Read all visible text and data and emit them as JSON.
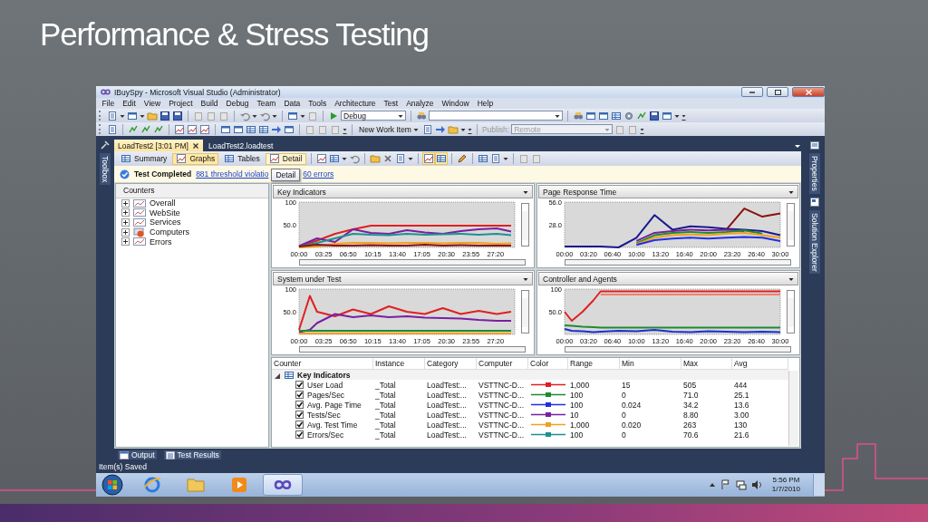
{
  "slide": {
    "title": "Performance & Stress Testing"
  },
  "window": {
    "title": "IBuySpy - Microsoft Visual Studio (Administrator)"
  },
  "menu": [
    "File",
    "Edit",
    "View",
    "Project",
    "Build",
    "Debug",
    "Team",
    "Data",
    "Tools",
    "Architecture",
    "Test",
    "Analyze",
    "Window",
    "Help"
  ],
  "toolbar": {
    "configuration": "Debug"
  },
  "toolbar2": {
    "new_work_item": "New Work Item",
    "publish_label": "Publish:",
    "publish_target": "Remote"
  },
  "side_tabs": {
    "left": [
      "Toolbox"
    ],
    "right": [
      "Properties",
      "Solution Explorer"
    ]
  },
  "document_tabs": [
    {
      "label": "LoadTest2 [3:01 PM]",
      "selected": true
    },
    {
      "label": "LoadTest2.loadtest",
      "selected": false
    }
  ],
  "view_buttons": [
    {
      "label": "Summary",
      "selected": false
    },
    {
      "label": "Graphs",
      "selected": true
    },
    {
      "label": "Tables",
      "selected": false
    },
    {
      "label": "Detail",
      "selected": false
    }
  ],
  "tooltip": "Detail",
  "status": {
    "title": "Test Completed",
    "link": "881 threshold violatio",
    "link_end": "60 errors"
  },
  "counters": {
    "title": "Counters",
    "items": [
      {
        "label": "Overall",
        "kind": "graph",
        "expanded": false
      },
      {
        "label": "WebSite",
        "kind": "graph",
        "expanded": false
      },
      {
        "label": "Services",
        "kind": "graph",
        "expanded": false
      },
      {
        "label": "Computers",
        "kind": "computer",
        "expanded": false
      },
      {
        "label": "Errors",
        "kind": "graph",
        "expanded": false
      }
    ]
  },
  "graphs": [
    {
      "title": "Key Indicators",
      "chart_data": {
        "type": "line",
        "xlim": [
          0,
          30
        ],
        "ylim": [
          0,
          100
        ],
        "x": [
          0,
          2.5,
          5,
          7.5,
          10,
          12.5,
          15,
          17.5,
          20,
          22.5,
          25,
          27.5,
          29.5
        ],
        "xticks": [
          {
            "value": 0,
            "label": "00:00"
          },
          {
            "value": 3.417,
            "label": "03:25"
          },
          {
            "value": 6.833,
            "label": "06:50"
          },
          {
            "value": 10.25,
            "label": "10:15"
          },
          {
            "value": 13.667,
            "label": "13:40"
          },
          {
            "value": 17.083,
            "label": "17:05"
          },
          {
            "value": 20.5,
            "label": "20:30"
          },
          {
            "value": 23.917,
            "label": "23:55"
          },
          {
            "value": 27.333,
            "label": "27:20"
          }
        ],
        "yticks": [
          {
            "value": 100,
            "label": "100"
          },
          {
            "value": 50,
            "label": "50.0"
          }
        ],
        "series": [
          {
            "color": "#e02020",
            "values": [
              2,
              15,
              30,
              40,
              48,
              48,
              48,
              48,
              48,
              48,
              48,
              48,
              48
            ]
          },
          {
            "color": "#7a1fa0",
            "values": [
              3,
              20,
              12,
              40,
              32,
              30,
              38,
              33,
              30,
              36,
              40,
              42,
              35
            ]
          },
          {
            "color": "#1f9090",
            "values": [
              2,
              10,
              20,
              30,
              28,
              27,
              30,
              28,
              29,
              30,
              28,
              30,
              27
            ]
          },
          {
            "color": "#f0a020",
            "values": [
              0,
              2,
              8,
              10,
              10,
              9,
              10,
              10,
              9,
              10,
              10,
              8,
              9
            ]
          },
          {
            "color": "#8b1010",
            "values": [
              2,
              6,
              4,
              4,
              5,
              4,
              4,
              6,
              4,
              5,
              4,
              4,
              4
            ]
          }
        ]
      }
    },
    {
      "title": "Page Response Time",
      "chart_data": {
        "type": "line",
        "xlim": [
          0,
          30
        ],
        "ylim": [
          0,
          56
        ],
        "x": [
          0,
          2.5,
          5,
          7.5,
          10,
          12.5,
          15,
          17.5,
          20,
          22.5,
          25,
          27.5,
          30
        ],
        "xticks": [
          {
            "value": 0,
            "label": "00:00"
          },
          {
            "value": 3.333,
            "label": "03:20"
          },
          {
            "value": 6.667,
            "label": "06:40"
          },
          {
            "value": 10,
            "label": "10:00"
          },
          {
            "value": 13.333,
            "label": "13:20"
          },
          {
            "value": 16.667,
            "label": "16:40"
          },
          {
            "value": 20,
            "label": "20:00"
          },
          {
            "value": 23.333,
            "label": "23:20"
          },
          {
            "value": 26.667,
            "label": "26:40"
          },
          {
            "value": 30,
            "label": "30:00"
          }
        ],
        "yticks": [
          {
            "value": 56,
            "label": "56.0"
          },
          {
            "value": 28,
            "label": "28.0"
          }
        ],
        "series": [
          {
            "color": "#8b1010",
            "values": [
              null,
              null,
              null,
              null,
              null,
              null,
              null,
              null,
              null,
              22,
              48,
              38,
              42
            ]
          },
          {
            "color": "#1a1a90",
            "values": [
              1,
              1,
              1,
              0,
              12,
              40,
              22,
              26,
              25,
              23,
              22,
              20,
              15
            ]
          },
          {
            "color": "#7a1fa0",
            "values": [
              null,
              null,
              null,
              null,
              8,
              18,
              20,
              22,
              21,
              22,
              20,
              null,
              null
            ]
          },
          {
            "color": "#208a30",
            "values": [
              null,
              null,
              null,
              null,
              5,
              15,
              18,
              19,
              18,
              19,
              21,
              17,
              null
            ]
          },
          {
            "color": "#f0a020",
            "values": [
              null,
              null,
              null,
              null,
              4,
              12,
              15,
              16,
              15,
              17,
              18,
              15,
              12
            ]
          },
          {
            "color": "#2030e0",
            "values": [
              null,
              null,
              null,
              null,
              3,
              9,
              11,
              12,
              11,
              12,
              13,
              12,
              8
            ]
          }
        ]
      }
    },
    {
      "title": "System under Test",
      "chart_data": {
        "type": "line",
        "xlim": [
          0,
          30
        ],
        "ylim": [
          0,
          100
        ],
        "x": [
          0,
          1.5,
          2.5,
          5,
          7.5,
          10,
          12.5,
          15,
          17.5,
          20,
          22.5,
          25,
          27.5,
          29.5
        ],
        "xticks": [
          {
            "value": 0,
            "label": "00:00"
          },
          {
            "value": 3.417,
            "label": "03:25"
          },
          {
            "value": 6.833,
            "label": "06:50"
          },
          {
            "value": 10.25,
            "label": "10:15"
          },
          {
            "value": 13.667,
            "label": "13:40"
          },
          {
            "value": 17.083,
            "label": "17:05"
          },
          {
            "value": 20.5,
            "label": "20:30"
          },
          {
            "value": 23.917,
            "label": "23:55"
          },
          {
            "value": 27.333,
            "label": "27:20"
          }
        ],
        "yticks": [
          {
            "value": 100,
            "label": "100"
          },
          {
            "value": 50,
            "label": "50.0"
          }
        ],
        "series": [
          {
            "color": "#e02020",
            "values": [
              10,
              85,
              50,
              40,
              55,
              45,
              62,
              50,
              45,
              58,
              45,
              52,
              45,
              50
            ]
          },
          {
            "color": "#7a1fa0",
            "values": [
              5,
              10,
              25,
              45,
              38,
              42,
              38,
              40,
              37,
              36,
              35,
              32,
              30,
              30
            ]
          },
          {
            "color": "#208a30",
            "values": [
              8,
              8,
              8,
              8,
              8,
              8,
              8,
              8,
              8,
              8,
              8,
              8,
              8,
              8
            ]
          },
          {
            "color": "#f0a020",
            "values": [
              2,
              2,
              2,
              2,
              2,
              2,
              2,
              2,
              2,
              2,
              2,
              2,
              2,
              2
            ]
          }
        ]
      }
    },
    {
      "title": "Controller and Agents",
      "chart_data": {
        "type": "line",
        "xlim": [
          0,
          30
        ],
        "ylim": [
          0,
          100
        ],
        "x": [
          0,
          1,
          2.5,
          4,
          5,
          7.5,
          10,
          12.5,
          15,
          17.5,
          20,
          22.5,
          25,
          27.5,
          30
        ],
        "xticks": [
          {
            "value": 0,
            "label": "00:00"
          },
          {
            "value": 3.333,
            "label": "03:20"
          },
          {
            "value": 6.667,
            "label": "06:40"
          },
          {
            "value": 10,
            "label": "10:00"
          },
          {
            "value": 13.333,
            "label": "13:20"
          },
          {
            "value": 16.667,
            "label": "16:40"
          },
          {
            "value": 20,
            "label": "20:00"
          },
          {
            "value": 23.333,
            "label": "23:20"
          },
          {
            "value": 26.667,
            "label": "26:40"
          },
          {
            "value": 30,
            "label": "30:00"
          }
        ],
        "yticks": [
          {
            "value": 100,
            "label": "100"
          },
          {
            "value": 50,
            "label": "50.0"
          }
        ],
        "series": [
          {
            "color": "#f08070",
            "values": [
              null,
              null,
              null,
              null,
              88,
              88,
              88,
              88,
              88,
              88,
              88,
              88,
              88,
              88,
              88
            ]
          },
          {
            "color": "#e02020",
            "values": [
              50,
              30,
              50,
              75,
              95,
              95,
              95,
              95,
              95,
              95,
              95,
              95,
              95,
              95,
              95
            ]
          },
          {
            "color": "#208a30",
            "values": [
              20,
              19,
              17,
              16,
              15,
              15,
              15,
              15,
              15,
              15,
              15,
              15,
              15,
              15,
              15
            ]
          },
          {
            "color": "#1a30d0",
            "values": [
              12,
              8,
              7,
              5,
              6,
              8,
              7,
              10,
              6,
              5,
              7,
              6,
              5,
              6,
              5
            ]
          }
        ]
      }
    }
  ],
  "table": {
    "columns": [
      "Counter",
      "Instance",
      "Category",
      "Computer",
      "Color",
      "Range",
      "Min",
      "Max",
      "Avg"
    ],
    "group": {
      "label": "Key Indicators",
      "expanded": true
    },
    "rows": [
      {
        "checked": true,
        "counter": "User Load",
        "instance": "_Total",
        "category": "LoadTest:...",
        "computer": "VSTTNC-D...",
        "color": "#e02020",
        "range": "1,000",
        "min": "15",
        "max": "505",
        "avg": "444"
      },
      {
        "checked": true,
        "counter": "Pages/Sec",
        "instance": "_Total",
        "category": "LoadTest:...",
        "computer": "VSTTNC-D...",
        "color": "#208a30",
        "range": "100",
        "min": "0",
        "max": "71.0",
        "avg": "25.1"
      },
      {
        "checked": true,
        "counter": "Avg. Page Time",
        "instance": "_Total",
        "category": "LoadTest:...",
        "computer": "VSTTNC-D...",
        "color": "#2030e0",
        "range": "100",
        "min": "0.024",
        "max": "34.2",
        "avg": "13.6"
      },
      {
        "checked": true,
        "counter": "Tests/Sec",
        "instance": "_Total",
        "category": "LoadTest:...",
        "computer": "VSTTNC-D...",
        "color": "#7a1fa0",
        "range": "10",
        "min": "0",
        "max": "8.80",
        "avg": "3.00"
      },
      {
        "checked": true,
        "counter": "Avg. Test Time",
        "instance": "_Total",
        "category": "LoadTest:...",
        "computer": "VSTTNC-D...",
        "color": "#f0a020",
        "range": "1,000",
        "min": "0.020",
        "max": "263",
        "avg": "130"
      },
      {
        "checked": true,
        "counter": "Errors/Sec",
        "instance": "_Total",
        "category": "LoadTest:...",
        "computer": "VSTTNC-D...",
        "color": "#1f9090",
        "range": "100",
        "min": "0",
        "max": "70.6",
        "avg": "21.6"
      }
    ]
  },
  "bottom_tabs": [
    {
      "label": "Output",
      "kind": "output"
    },
    {
      "label": "Test Results",
      "kind": "results"
    }
  ],
  "status_bar": "Item(s) Saved",
  "taskbar": {
    "apps": [
      {
        "kind": "browser",
        "selected": false
      },
      {
        "kind": "folder",
        "selected": false
      },
      {
        "kind": "media",
        "selected": false
      },
      {
        "kind": "studio",
        "selected": true
      }
    ],
    "time": "5:56 PM",
    "date": "1/7/2010"
  }
}
